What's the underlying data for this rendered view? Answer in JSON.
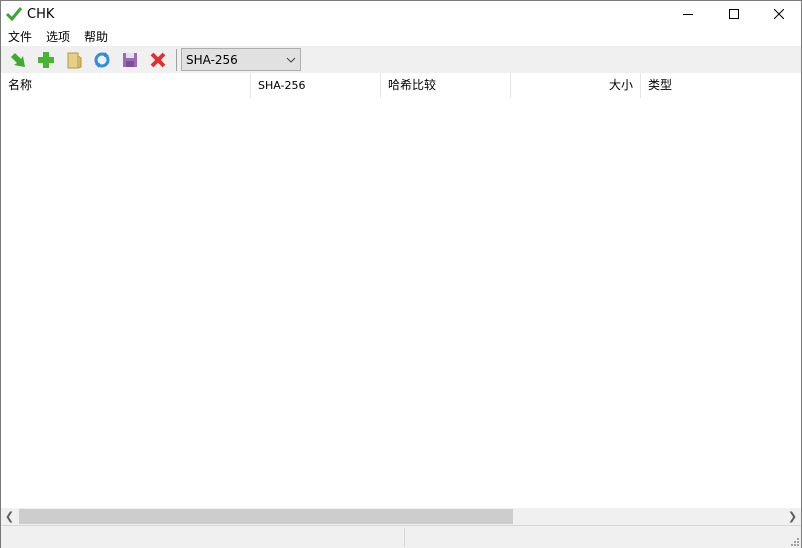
{
  "window": {
    "title": "CHK",
    "app_icon": "checkmark-icon"
  },
  "menu": [
    "文件",
    "选项",
    "帮助"
  ],
  "toolbar": {
    "buttons": [
      {
        "name": "import-button",
        "icon": "arrow-down-right-icon"
      },
      {
        "name": "add-button",
        "icon": "plus-icon"
      },
      {
        "name": "open-folder-button",
        "icon": "folder-icon"
      },
      {
        "name": "refresh-button",
        "icon": "refresh-icon"
      },
      {
        "name": "save-button",
        "icon": "floppy-icon"
      },
      {
        "name": "delete-button",
        "icon": "x-icon"
      }
    ],
    "hash_algorithm": "SHA-256"
  },
  "columns": [
    "名称",
    "SHA-256",
    "哈希比较",
    "大小",
    "类型"
  ],
  "rows": [],
  "scrollbar": {
    "horizontal_thumb_fraction": 0.645
  },
  "status": [
    "",
    ""
  ]
}
